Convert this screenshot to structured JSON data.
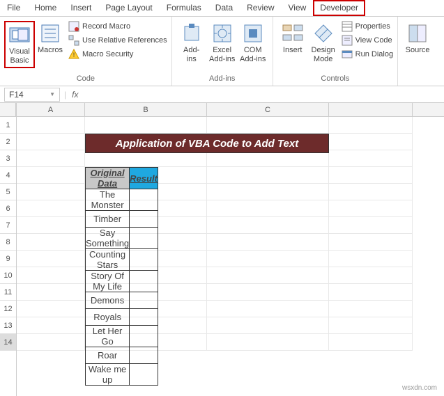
{
  "menu": {
    "file": "File",
    "home": "Home",
    "insert": "Insert",
    "page_layout": "Page Layout",
    "formulas": "Formulas",
    "data": "Data",
    "review": "Review",
    "view": "View",
    "developer": "Developer"
  },
  "ribbon": {
    "code": {
      "label": "Code",
      "visual_basic": "Visual\nBasic",
      "macros": "Macros",
      "record_macro": "Record Macro",
      "use_relative": "Use Relative References",
      "macro_security": "Macro Security"
    },
    "addins": {
      "label": "Add-ins",
      "addins": "Add-\nins",
      "excel_addins": "Excel\nAdd-ins",
      "com_addins": "COM\nAdd-ins"
    },
    "controls": {
      "label": "Controls",
      "insert": "Insert",
      "design_mode": "Design\nMode",
      "properties": "Properties",
      "view_code": "View Code",
      "run_dialog": "Run Dialog"
    },
    "source": "Source"
  },
  "formula_bar": {
    "name_box": "F14",
    "fx": "fx",
    "value": ""
  },
  "columns": [
    "A",
    "B",
    "C"
  ],
  "rows": [
    "1",
    "2",
    "3",
    "4",
    "5",
    "6",
    "7",
    "8",
    "9",
    "10",
    "11",
    "12",
    "13",
    "14"
  ],
  "selected_row": "14",
  "sheet": {
    "title": "Application of VBA Code to Add Text",
    "headers": {
      "original": "Original Data",
      "result": "Result"
    },
    "data": [
      "The Monster",
      "Timber",
      "Say Something",
      "Counting Stars",
      "Story Of My Life",
      "Demons",
      "Royals",
      "Let Her Go",
      "Roar",
      "Wake me up"
    ]
  },
  "watermark": "wsxdn.com"
}
